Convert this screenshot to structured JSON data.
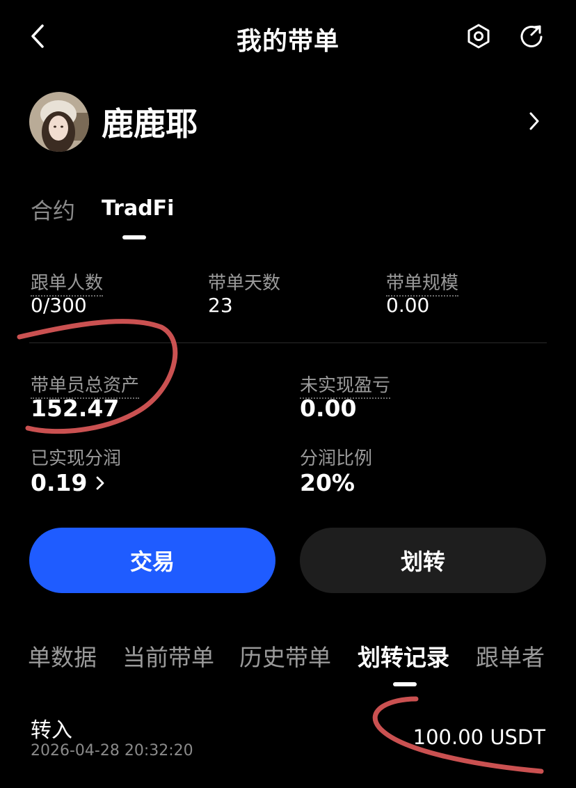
{
  "header": {
    "title": "我的带单",
    "icons": [
      "back-icon",
      "settings-hex-icon",
      "refresh-share-icon"
    ]
  },
  "profile": {
    "name": "鹿鹿耶",
    "chevron_icon": "chevron-right-icon"
  },
  "product_tabs": [
    {
      "label": "合约",
      "active": false
    },
    {
      "label": "TradFi",
      "active": true
    }
  ],
  "stats_row1": [
    {
      "label": "跟单人数",
      "value": "0/300"
    },
    {
      "label": "带单天数",
      "value": "23"
    },
    {
      "label": "带单规模",
      "value": "0.00"
    }
  ],
  "stats_row2": [
    {
      "label": "带单员总资产",
      "value": "152.47"
    },
    {
      "label": "未实现盈亏",
      "value": "0.00"
    }
  ],
  "stats_row3": [
    {
      "label": "已实现分润",
      "value": "0.19"
    },
    {
      "label": "分润比例",
      "value": "20%"
    }
  ],
  "actions": {
    "trade_label": "交易",
    "transfer_label": "划转"
  },
  "record_tabs": [
    {
      "label": "单数据",
      "active": false
    },
    {
      "label": "当前带单",
      "active": false
    },
    {
      "label": "历史带单",
      "active": false
    },
    {
      "label": "划转记录",
      "active": true
    },
    {
      "label": "跟单者",
      "active": false
    }
  ],
  "records": [
    {
      "type": "转入",
      "time": "2026-04-28 20:32:20",
      "amount": "100.00 USDT"
    }
  ],
  "colors": {
    "background": "#000000",
    "primary": "#1f5cff",
    "secondary_button": "#1e1e1e",
    "muted_text": "#9a9a9a",
    "annotation": "#e05a5a"
  }
}
